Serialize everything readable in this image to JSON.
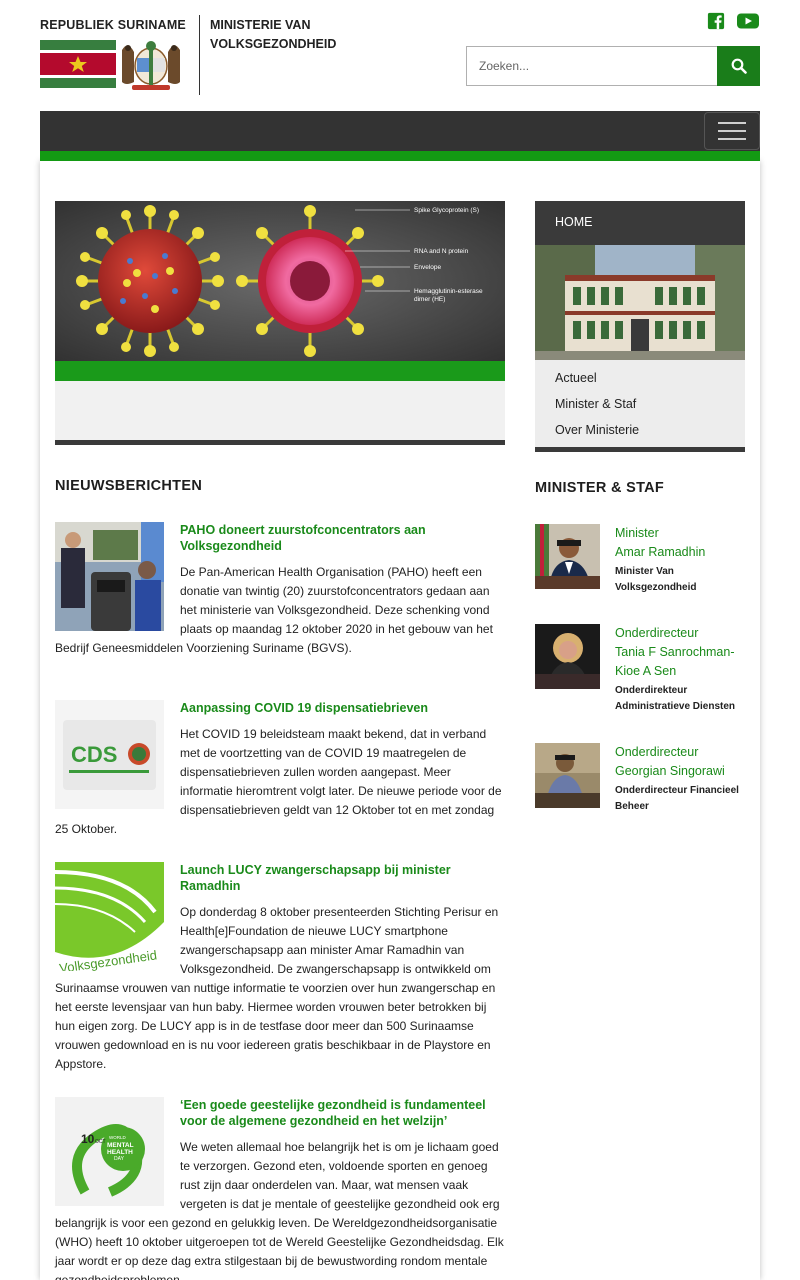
{
  "header": {
    "logo_title": "REPUBLIEK SURINAME",
    "ministry_line1": "MINISTERIE VAN",
    "ministry_line2": "VOLKSGEZONDHEID",
    "social_icons": [
      "facebook-icon",
      "youtube-icon"
    ],
    "search_placeholder": "Zoeken...",
    "search_icon": "search-icon"
  },
  "nav": {
    "toggler_icon": "hamburger-menu-icon"
  },
  "colors": {
    "brand_green": "#1a8a1a",
    "nav_dark": "#333333",
    "flag_green": "#377e3f",
    "flag_red": "#b40a2d",
    "flag_star": "#ecc81d"
  },
  "news": {
    "heading": "NIEUWSBERICHTEN",
    "items": [
      {
        "title": "PAHO doneert zuurstofconcentrators aan Volksgezondheid",
        "body": "De Pan-American Health Organisation (PAHO) heeft een donatie van twintig (20) zuurstofconcentrators gedaan aan het ministerie van Volksgezondheid. Deze schenking vond plaats op maandag 12 oktober 2020 in het gebouw van het Bedrijf Geneesmiddelen Voorziening Suriname (BGVS)."
      },
      {
        "title": "Aanpassing COVID 19 dispensatiebrieven",
        "body": "Het COVID 19 beleidsteam maakt bekend, dat in verband met de voortzetting van de COVID 19 maatregelen de dispensatiebrieven zullen worden aangepast. Meer informatie hieromtrent volgt later. De nieuwe periode voor de dispensatiebrieven geldt van 12 Oktober tot en met zondag 25 Oktober.",
        "thumb_text": "CDS"
      },
      {
        "title": "Launch LUCY zwangerschapsapp bij minister Ramadhin",
        "body": "Op donderdag 8 oktober presenteerden Stichting Perisur en Health[e]Foundation de nieuwe LUCY smartphone zwangerschapsapp aan minister Amar Ramadhin van Volksgezondheid. De zwangerschapsapp is ontwikkeld om Surinaamse vrouwen van nuttige informatie te voorzien over hun zwangerschap en het eerste levensjaar van hun baby. Hiermee worden vrouwen beter betrokken bij hun eigen zorg. De LUCY app is in de testfase door meer dan 500 Surinaamse vrouwen gedownload en is nu voor iedereen gratis beschikbaar in de Playstore en Appstore.",
        "thumb_text": "Volksgezondheid"
      },
      {
        "title": "‘Een goede geestelijke gezondheid is fundamenteel voor de algemene gezondheid en het welzijn’",
        "body": "We weten allemaal hoe belangrijk het is om je lichaam goed te verzorgen. Gezond eten, voldoende sporten en genoeg rust zijn daar onderdelen van. Maar, wat mensen vaak vergeten is dat je mentale of geestelijke gezondheid ook erg belangrijk is voor een gezond en gelukkig leven. De Wereldgezondheidsorganisatie (WHO) heeft 10 oktober uitgeroepen tot de Wereld Geestelijke Gezondheidsdag. Elk jaar wordt er op deze dag extra stilgestaan bij de bewustwording rondom mentale gezondheidsproblemen.",
        "thumb_date": "10",
        "thumb_month": "OCT",
        "thumb_label": "WORLD MENTAL HEALTH DAY"
      }
    ]
  },
  "slider": {
    "labels": [
      "Spike Glycoprotein (S)",
      "RNA and N protein",
      "Envelope",
      "Hemagglutinin-esterase dimer (HE)"
    ]
  },
  "sidebar": {
    "home_label": "HOME",
    "links": [
      "Actueel",
      "Minister & Staf",
      "Over Ministerie"
    ]
  },
  "staff": {
    "heading": "MINISTER & STAF",
    "members": [
      {
        "role": "Minister",
        "name": "Amar Ramadhin",
        "sub": "Minister Van Volksgezondheid"
      },
      {
        "role": "Onderdirecteur",
        "name": "Tania F Sanrochman-Kioe A Sen",
        "sub": "Onderdirekteur Administratieve Diensten"
      },
      {
        "role": "Onderdirecteur",
        "name": "Georgian Singorawi",
        "sub": "Onderdirecteur Financieel Beheer"
      }
    ]
  }
}
